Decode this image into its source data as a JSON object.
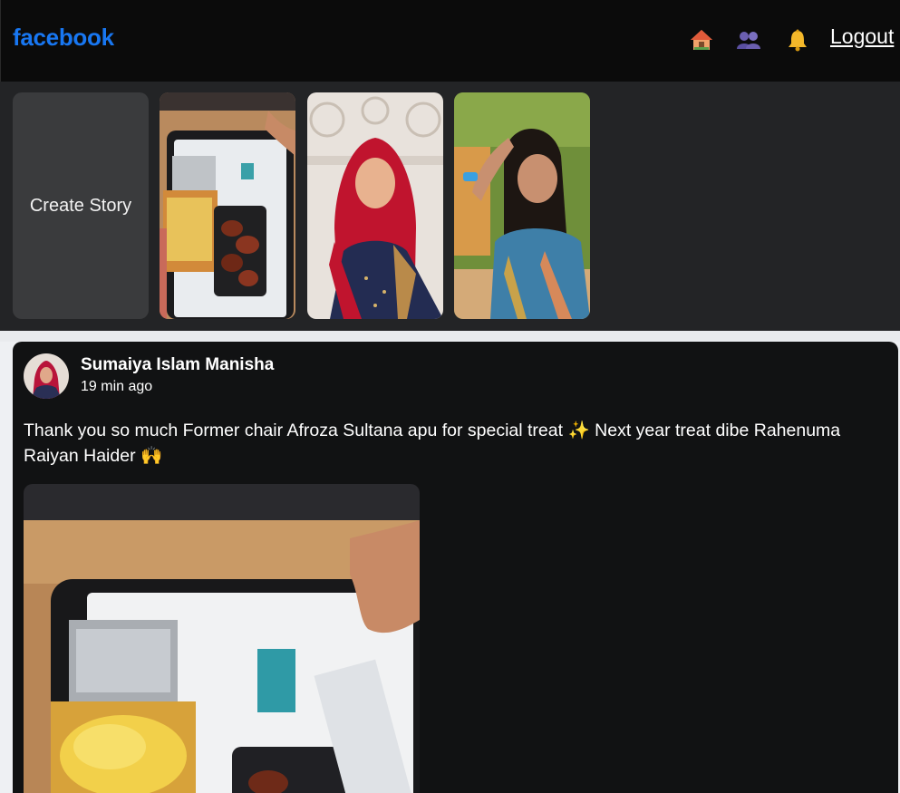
{
  "app": {
    "brand": "facebook"
  },
  "nav": {
    "icons": [
      "home-icon",
      "friends-icon",
      "bell-icon"
    ],
    "logout_label": "Logout"
  },
  "stories": {
    "create_label": "Create Story",
    "items": [
      {
        "subject": "food tray photo"
      },
      {
        "subject": "woman in red hijab"
      },
      {
        "subject": "woman in blue dress"
      }
    ]
  },
  "post": {
    "author": "Sumaiya Islam Manisha",
    "time": "19 min ago",
    "text": "Thank you so much Former chair Afroza Sultana apu for special treat ✨  Next year treat dibe Rahenuma Raiyan Haider 🙌"
  },
  "colors": {
    "brand": "#1877f2",
    "topbar": "#0b0b0b",
    "stories_bg": "#232426",
    "post_bg": "#111213"
  }
}
